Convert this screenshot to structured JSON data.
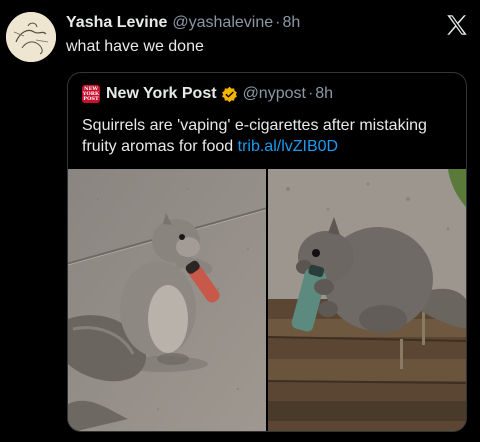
{
  "tweet": {
    "author_name": "Yasha Levine",
    "author_handle": "@yashalevine",
    "separator": "·",
    "time": "8h",
    "text": "what have we done",
    "avatar_icon": "sketch-avatar",
    "brand_icon": "x-logo-icon"
  },
  "quote": {
    "source_logo_text": "NEW YORK POST",
    "author_name": "New York Post",
    "verified_icon": "gold-verified-badge",
    "verified_color": "#f4b400",
    "author_handle": "@nypost",
    "separator": "·",
    "time": "8h",
    "text": "Squirrels are 'vaping' e-cigarettes after mistaking fruity aromas for food",
    "link": "trib.al/lvZIB0D",
    "link_color": "#1d9bf0",
    "media": [
      {
        "name": "squirrel-with-red-vape-photo"
      },
      {
        "name": "squirrel-with-green-vape-photo"
      }
    ]
  },
  "colors": {
    "background": "#000000",
    "text": "#e7e9ea",
    "secondary_text": "#8b98a5",
    "border": "#333639",
    "nypost_red": "#c8102e"
  }
}
